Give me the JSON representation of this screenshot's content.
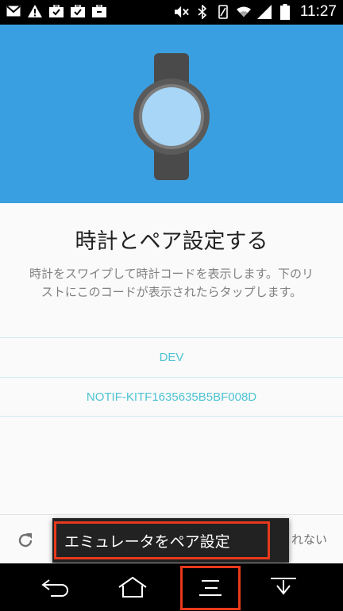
{
  "status_bar": {
    "time": "11:27",
    "left_icons": [
      "gmail-icon",
      "warning-icon",
      "briefcase-check-icon",
      "briefcase-check-icon",
      "briefcase-icon"
    ],
    "right_icons": [
      "mute-icon",
      "bluetooth-icon",
      "vibrate-icon",
      "wifi-icon",
      "signal-icon",
      "battery-icon"
    ]
  },
  "hero": {
    "background": "#3a9fe0"
  },
  "pairing": {
    "title": "時計とペア設定する",
    "description": "時計をスワイプして時計コードを表示します。下のリストにこのコードが表示されたらタップします。",
    "devices": [
      "DEV",
      "NOTIF-KITF1635635B5BF008D"
    ]
  },
  "bottom_bar": {
    "right_partial_text": "れない"
  },
  "popup_menu": {
    "items": [
      "エミュレータをペア設定"
    ]
  },
  "colors": {
    "accent": "#4ec3d3",
    "highlight": "#e8391c"
  }
}
